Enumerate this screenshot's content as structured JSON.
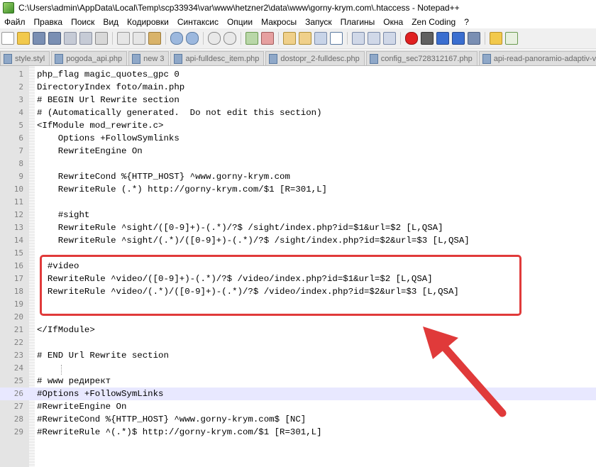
{
  "window": {
    "title": "C:\\Users\\admin\\AppData\\Local\\Temp\\scp33934\\var\\www\\hetzner2\\data\\www\\gorny-krym.com\\.htaccess - Notepad++"
  },
  "menu": [
    "Файл",
    "Правка",
    "Поиск",
    "Вид",
    "Кодировки",
    "Синтаксис",
    "Опции",
    "Макросы",
    "Запуск",
    "Плагины",
    "Окна",
    "Zen Coding",
    "?"
  ],
  "tabs": [
    "style.styl",
    "pogoda_api.php",
    "new  3",
    "api-fulldesc_item.php",
    "dostopr_2-fulldesc.php",
    "config_sec728312167.php",
    "api-read-panoramio-adaptiv-vko"
  ],
  "editor": {
    "current_line": 26,
    "lines": [
      {
        "n": "1",
        "text": "php_flag magic_quotes_gpc 0"
      },
      {
        "n": "2",
        "text": "DirectoryIndex foto/main.php"
      },
      {
        "n": "3",
        "text": "# BEGIN Url Rewrite section"
      },
      {
        "n": "4",
        "text": "# (Automatically generated.  Do not edit this section)"
      },
      {
        "n": "5",
        "text": "<IfModule mod_rewrite.c>"
      },
      {
        "n": "6",
        "text": "    Options +FollowSymlinks"
      },
      {
        "n": "7",
        "text": "    RewriteEngine On"
      },
      {
        "n": "8",
        "text": ""
      },
      {
        "n": "9",
        "text": "    RewriteCond %{HTTP_HOST} ^www.gorny-krym.com"
      },
      {
        "n": "10",
        "text": "    RewriteRule (.*) http://gorny-krym.com/$1 [R=301,L]"
      },
      {
        "n": "11",
        "text": ""
      },
      {
        "n": "12",
        "text": "    #sight"
      },
      {
        "n": "13",
        "text": "    RewriteRule ^sight/([0-9]+)-(.*)/?$ /sight/index.php?id=$1&url=$2 [L,QSA]"
      },
      {
        "n": "14",
        "text": "    RewriteRule ^sight/(.*)/([0-9]+)-(.*)/?$ /sight/index.php?id=$2&url=$3 [L,QSA]"
      },
      {
        "n": "15",
        "text": ""
      },
      {
        "n": "16",
        "text": "  #video"
      },
      {
        "n": "17",
        "text": "  RewriteRule ^video/([0-9]+)-(.*)/?$ /video/index.php?id=$1&url=$2 [L,QSA]"
      },
      {
        "n": "18",
        "text": "  RewriteRule ^video/(.*)/([0-9]+)-(.*)/?$ /video/index.php?id=$2&url=$3 [L,QSA]"
      },
      {
        "n": "19",
        "text": ""
      },
      {
        "n": "20",
        "text": ""
      },
      {
        "n": "21",
        "text": "</IfModule>"
      },
      {
        "n": "22",
        "text": ""
      },
      {
        "n": "23",
        "text": "# END Url Rewrite section"
      },
      {
        "n": "24",
        "text": ""
      },
      {
        "n": "25",
        "text": "# www редирект"
      },
      {
        "n": "26",
        "text": "#Options +FollowSymLinks"
      },
      {
        "n": "27",
        "text": "#RewriteEngine On"
      },
      {
        "n": "28",
        "text": "#RewriteCond %{HTTP_HOST} ^www.gorny-krym.com$ [NC]"
      },
      {
        "n": "29",
        "text": "#RewriteRule ^(.*)$ http://gorny-krym.com/$1 [R=301,L]"
      }
    ]
  },
  "colors": {
    "highlight_box": "#e03a3a",
    "current_line": "#e8e8ff"
  }
}
